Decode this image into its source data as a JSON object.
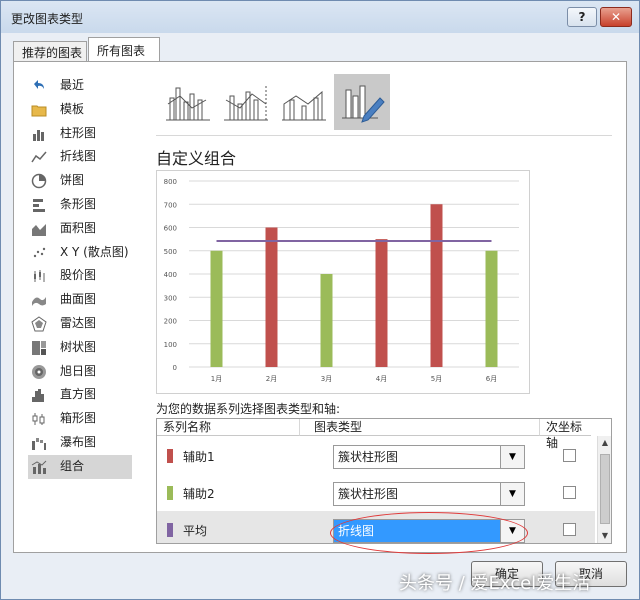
{
  "window": {
    "title": "更改图表类型",
    "help": "?",
    "close": "✕"
  },
  "tabs": [
    "推荐的图表",
    "所有图表"
  ],
  "sidebar": {
    "items": [
      {
        "label": "最近",
        "icon": "recent-icon"
      },
      {
        "label": "模板",
        "icon": "folder-icon"
      },
      {
        "label": "柱形图",
        "icon": "column-chart-icon"
      },
      {
        "label": "折线图",
        "icon": "line-chart-icon"
      },
      {
        "label": "饼图",
        "icon": "pie-chart-icon"
      },
      {
        "label": "条形图",
        "icon": "bar-chart-icon"
      },
      {
        "label": "面积图",
        "icon": "area-chart-icon"
      },
      {
        "label": "X Y (散点图)",
        "icon": "scatter-chart-icon"
      },
      {
        "label": "股价图",
        "icon": "stock-chart-icon"
      },
      {
        "label": "曲面图",
        "icon": "surface-chart-icon"
      },
      {
        "label": "雷达图",
        "icon": "radar-chart-icon"
      },
      {
        "label": "树状图",
        "icon": "treemap-icon"
      },
      {
        "label": "旭日图",
        "icon": "sunburst-icon"
      },
      {
        "label": "直方图",
        "icon": "histogram-icon"
      },
      {
        "label": "箱形图",
        "icon": "box-whisker-icon"
      },
      {
        "label": "瀑布图",
        "icon": "waterfall-icon"
      },
      {
        "label": "组合",
        "icon": "combo-chart-icon"
      }
    ],
    "selected_index": 16
  },
  "main": {
    "combo_title": "自定义组合",
    "series_prompt": "为您的数据系列选择图表类型和轴:",
    "table": {
      "headers": [
        "系列名称",
        "图表类型",
        "次坐标轴"
      ],
      "rows": [
        {
          "name": "辅助1",
          "type": "簇状柱形图",
          "color": "#c0504d",
          "secondary": false
        },
        {
          "name": "辅助2",
          "type": "簇状柱形图",
          "color": "#9bbb59",
          "secondary": false
        },
        {
          "name": "平均",
          "type": "折线图",
          "color": "#8064a2",
          "secondary": false
        }
      ]
    }
  },
  "footer": {
    "ok": "确定",
    "cancel": "取消"
  },
  "watermark": "头条号 / 爱Excel爱生活",
  "chart_data": {
    "type": "bar",
    "categories": [
      "1月",
      "2月",
      "3月",
      "4月",
      "5月",
      "6月"
    ],
    "ylim": [
      0,
      800
    ],
    "yticks": [
      0,
      100,
      200,
      300,
      400,
      500,
      600,
      700,
      800
    ],
    "grid": true,
    "bars": [
      {
        "category": "1月",
        "value": 500,
        "color": "#9bbb59"
      },
      {
        "category": "2月",
        "value": 600,
        "color": "#c0504d"
      },
      {
        "category": "3月",
        "value": 400,
        "color": "#9bbb59"
      },
      {
        "category": "4月",
        "value": 550,
        "color": "#c0504d"
      },
      {
        "category": "5月",
        "value": 700,
        "color": "#c0504d"
      },
      {
        "category": "6月",
        "value": 500,
        "color": "#9bbb59"
      }
    ],
    "line": {
      "value": 541.67,
      "color": "#8064a2"
    }
  }
}
